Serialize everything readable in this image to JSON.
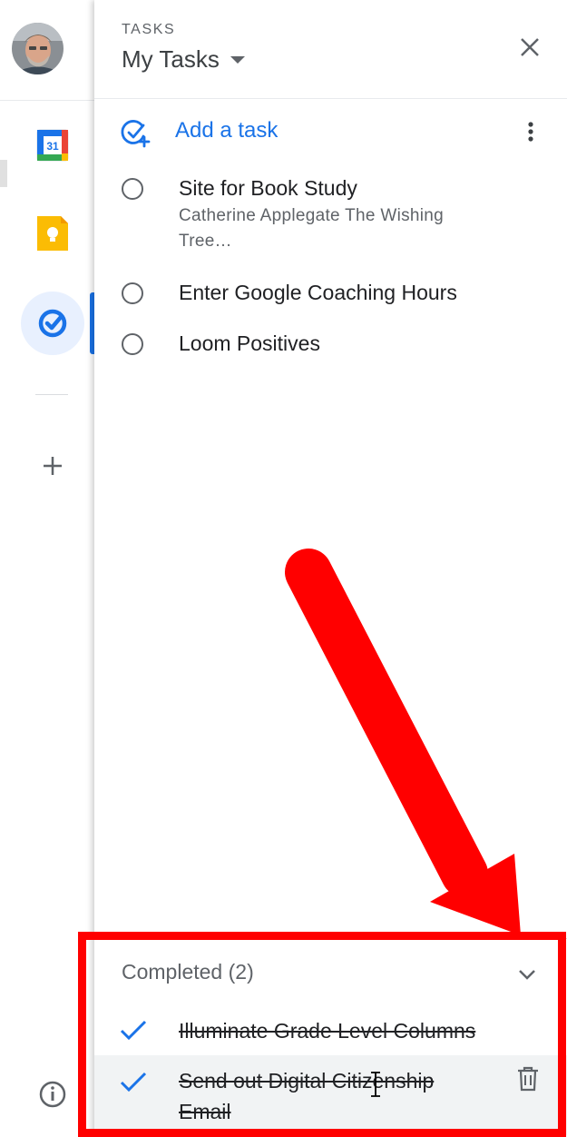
{
  "header": {
    "section_label": "TASKS",
    "list_name": "My Tasks"
  },
  "add_task": {
    "label": "Add a task"
  },
  "tasks": [
    {
      "title": "Site for Book Study",
      "description": "Catherine Applegate The Wishing Tree…"
    },
    {
      "title": "Enter Google Coaching Hours"
    },
    {
      "title": "Loom Positives"
    }
  ],
  "completed": {
    "header": "Completed (2)",
    "items": [
      {
        "title": "Illuminate Grade Level Columns"
      },
      {
        "title": "Send out Digital Citizenship Email"
      }
    ]
  },
  "rail": {
    "calendar_date": "31",
    "apps": [
      "calendar-icon",
      "keep-icon",
      "tasks-icon",
      "add-icon",
      "info-icon"
    ]
  },
  "colors": {
    "accent": "#1a73e8",
    "annotation": "#ff0000",
    "keep": "#fbbc04"
  }
}
